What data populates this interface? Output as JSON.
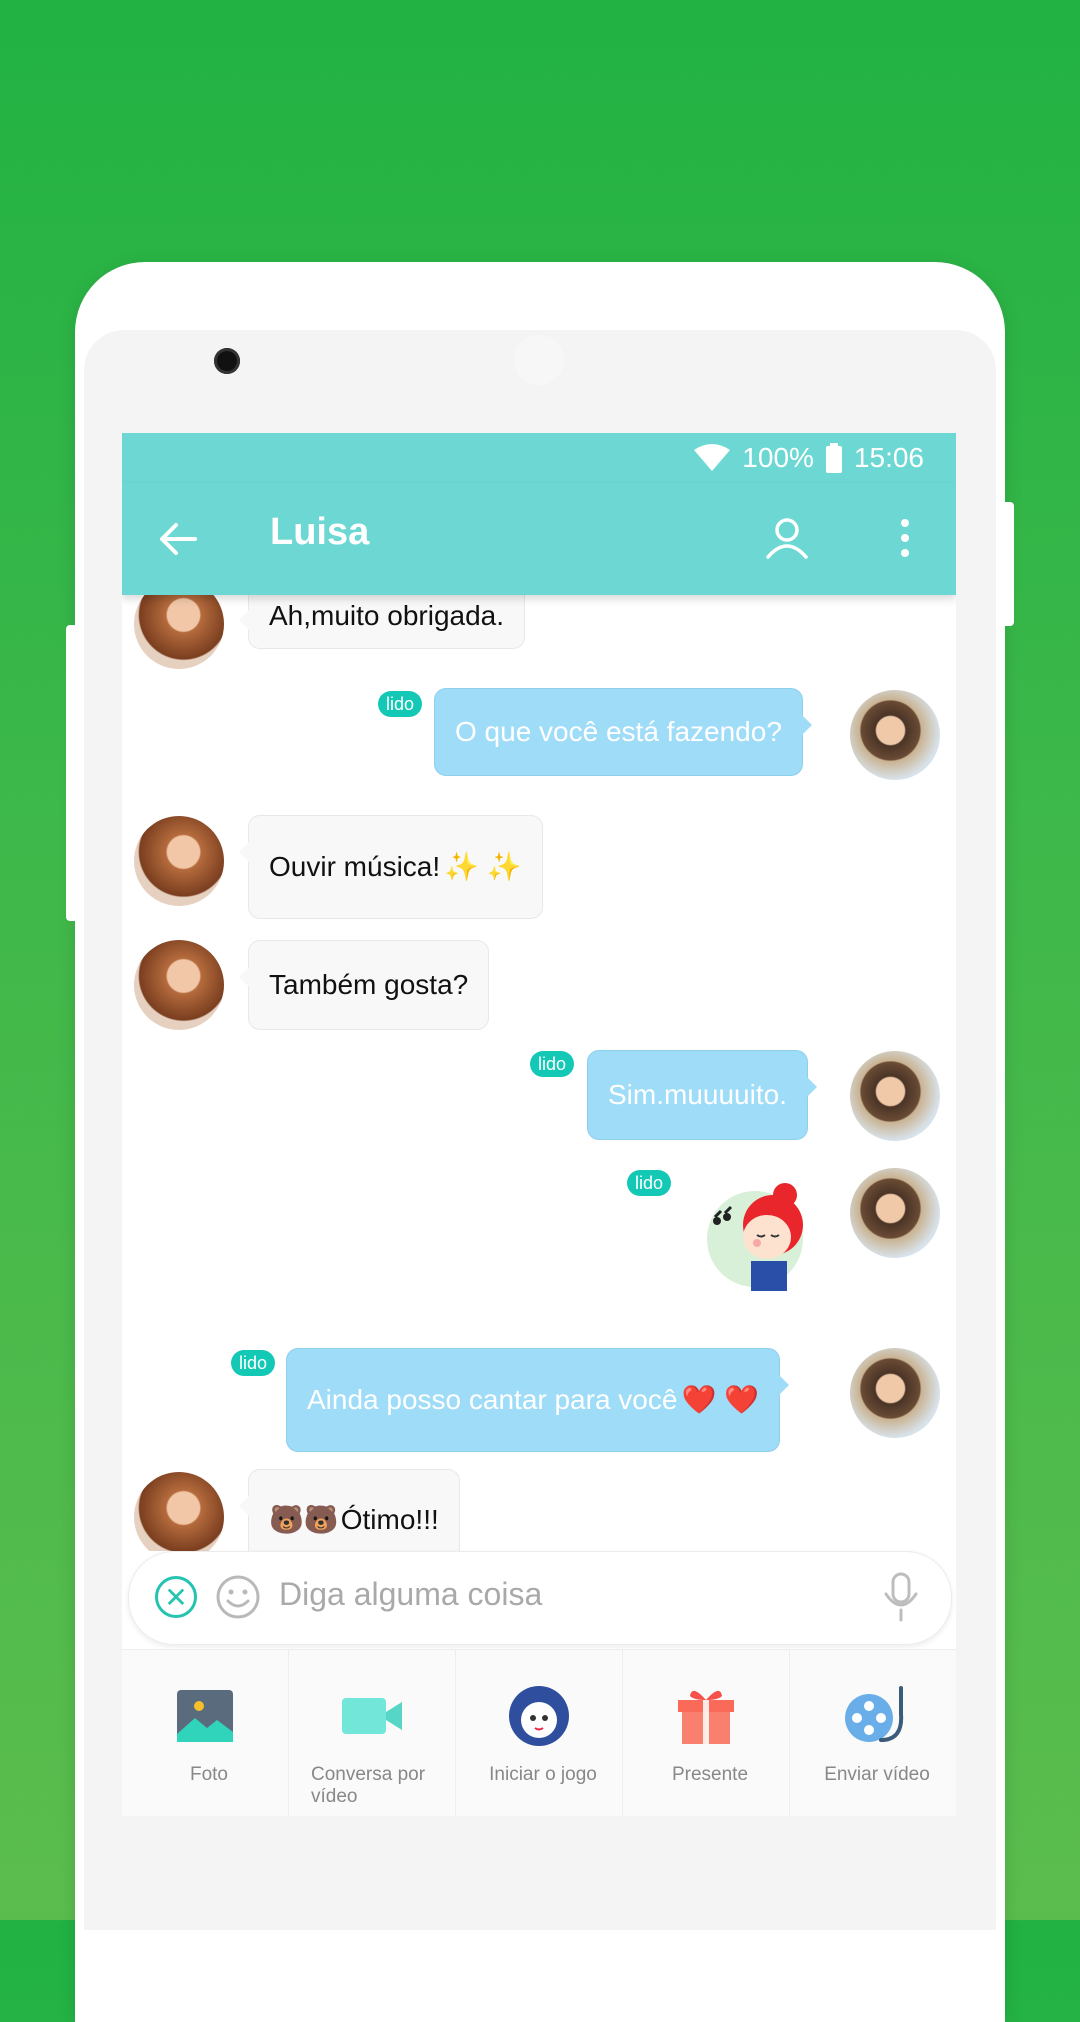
{
  "statusbar": {
    "battery": "100%",
    "time": "15:06"
  },
  "header": {
    "title": "Luisa"
  },
  "messages": {
    "m1": "Ah,muito obrigada.",
    "m2": "O que você está fazendo?",
    "m3": "Ouvir música!",
    "m4": "Também gosta?",
    "m5": "Sim.muuuuito.",
    "m7": "Ainda posso cantar para você",
    "m8": "Ótimo!!!",
    "read_label": "lido"
  },
  "input": {
    "placeholder": "Diga alguma coisa"
  },
  "tools": {
    "photo": "Foto",
    "video_chat": "Conversa por vídeo",
    "start_game": "Iniciar o jogo",
    "gift": "Presente",
    "send_video": "Enviar vídeo"
  },
  "colors": {
    "header": "#6dd8d3",
    "outgoing_bubble": "#9fdcf8",
    "read_badge": "#13c9b5",
    "background": "#21b243"
  }
}
